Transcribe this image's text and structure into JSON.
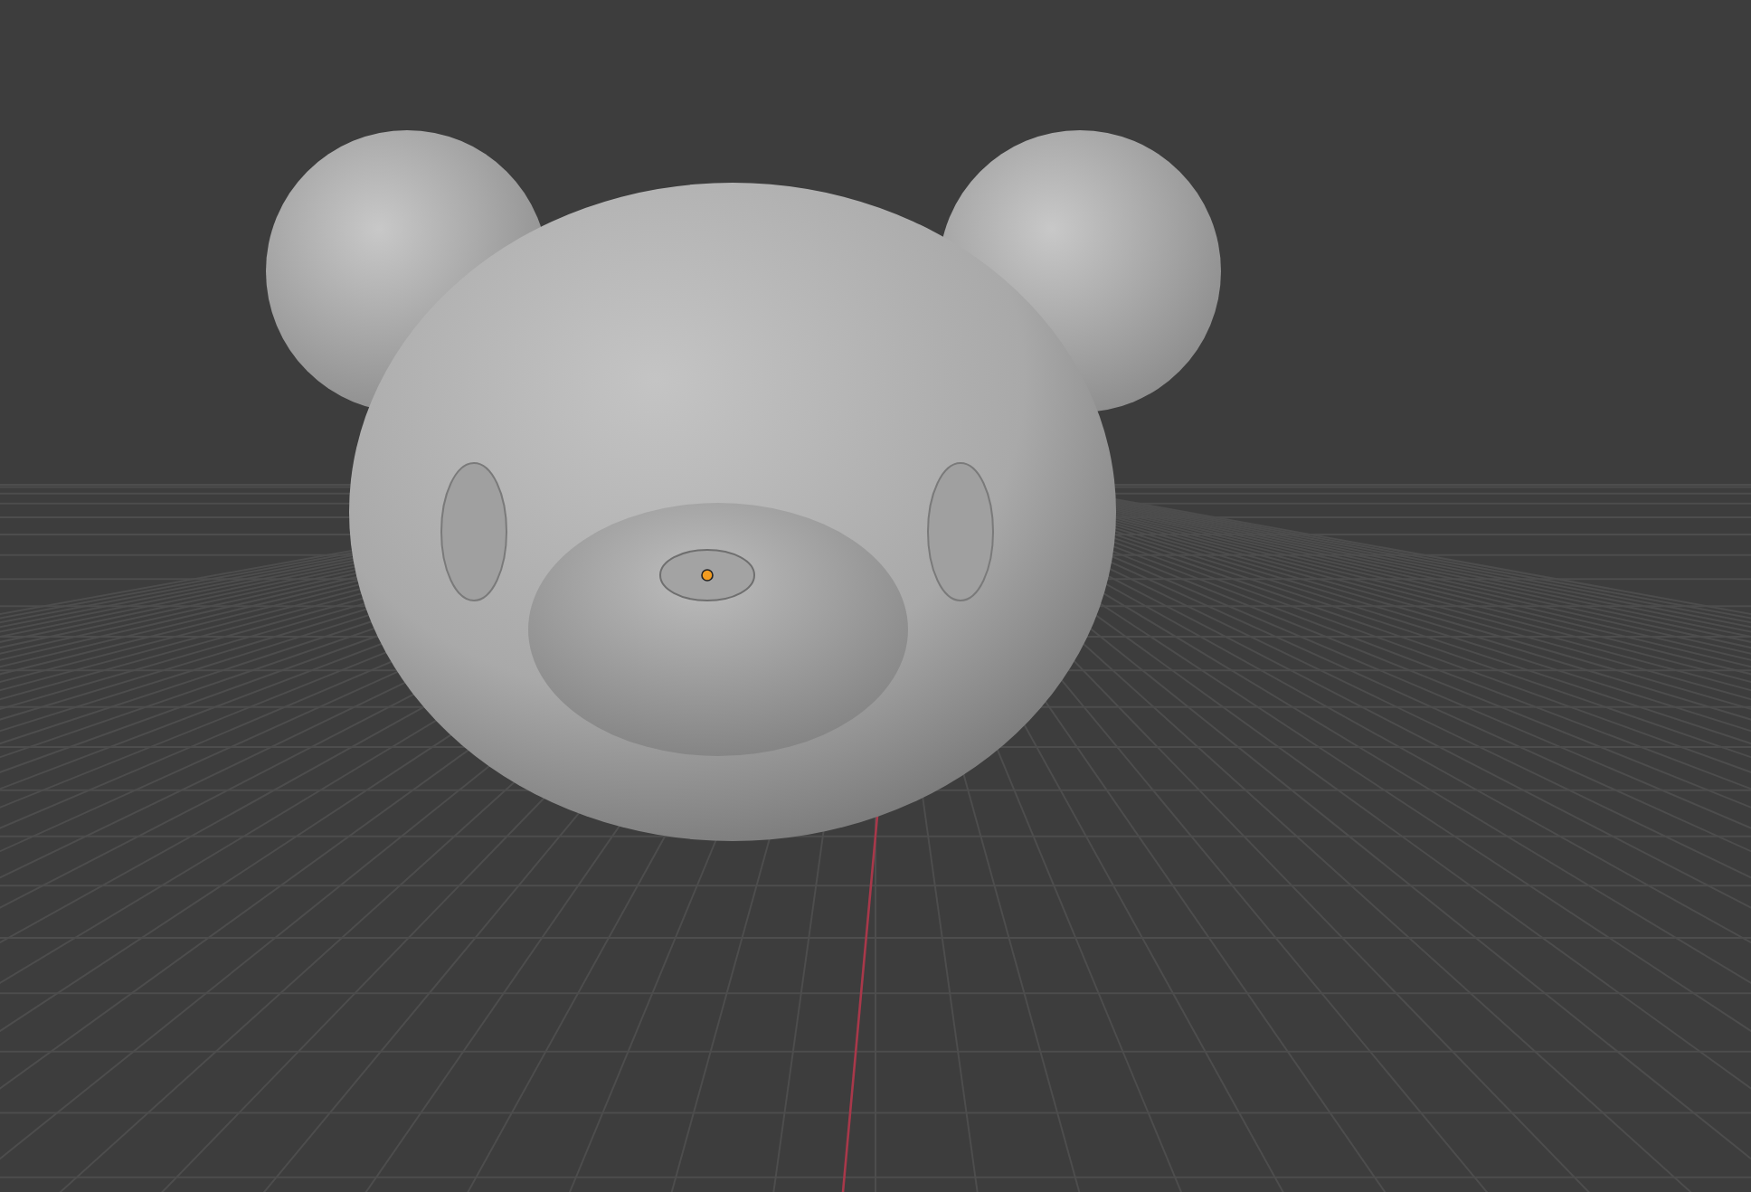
{
  "viewport": {
    "show_grid": true,
    "show_axis": true,
    "show_origin": true
  }
}
